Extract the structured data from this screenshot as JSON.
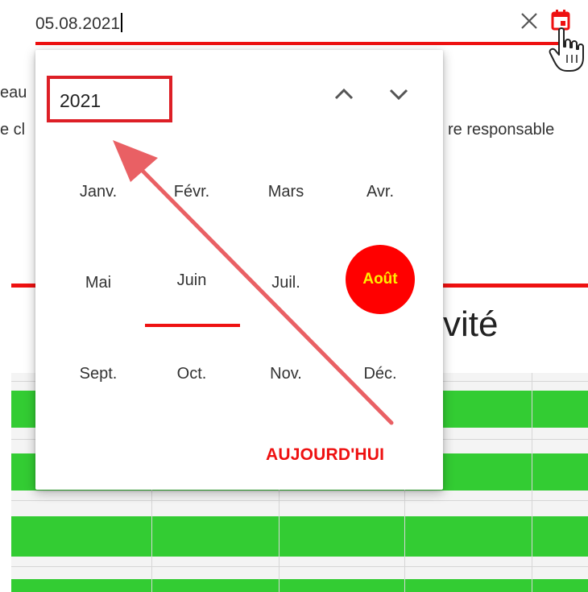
{
  "date_field": {
    "value": "05.08.2021"
  },
  "background": {
    "fragment_left_1": "eau",
    "fragment_left_2": "e cl",
    "fragment_right": "re responsable",
    "section_title_fragment": "vité"
  },
  "datepicker": {
    "year": "2021",
    "months": [
      "Janv.",
      "Févr.",
      "Mars",
      "Avr.",
      "Mai",
      "Juin",
      "Juil.",
      "Août",
      "Sept.",
      "Oct.",
      "Nov.",
      "Déc."
    ],
    "selected_month": "Août",
    "today_label": "AUJOURD'HUI"
  },
  "icons": {
    "clear": "close-icon",
    "calendar": "calendar-icon",
    "year_prev": "chevron-up-icon",
    "year_next": "chevron-down-icon",
    "cursor": "hand-pointer-cursor"
  },
  "colors": {
    "accent_red": "#ee1111",
    "selected_bg": "#ff0000",
    "selected_text": "#ffee00",
    "bar_green": "#33cc33",
    "annotation_red": "#e96064"
  }
}
